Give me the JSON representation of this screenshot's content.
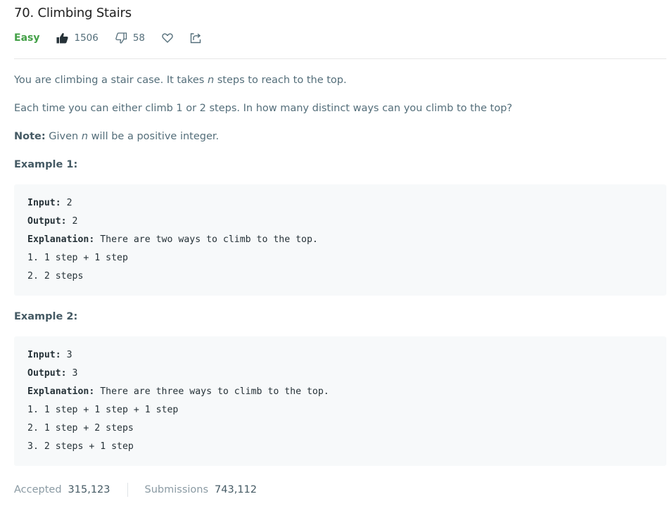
{
  "problem": {
    "title": "70. Climbing Stairs",
    "difficulty": "Easy",
    "likes": "1506",
    "dislikes": "58"
  },
  "description": {
    "p1_before": "You are climbing a stair case. It takes ",
    "p1_var": "n",
    "p1_after": " steps to reach to the top.",
    "p2": "Each time you can either climb 1 or 2 steps. In how many distinct ways can you climb to the top?",
    "note_label": "Note:",
    "note_before": " Given ",
    "note_var": "n",
    "note_after": " will be a positive integer."
  },
  "examples": [
    {
      "heading": "Example 1:",
      "input_label": "Input:",
      "input_value": " 2",
      "output_label": "Output:",
      "output_value": " 2",
      "explanation_label": "Explanation:",
      "explanation_value": " There are two ways to climb to the top.",
      "steps": [
        "1. 1 step + 1 step",
        "2. 2 steps"
      ]
    },
    {
      "heading": "Example 2:",
      "input_label": "Input:",
      "input_value": " 3",
      "output_label": "Output:",
      "output_value": " 3",
      "explanation_label": "Explanation:",
      "explanation_value": " There are three ways to climb to the top.",
      "steps": [
        "1. 1 step + 1 step + 1 step",
        "2. 1 step + 2 steps",
        "3. 2 steps + 1 step"
      ]
    }
  ],
  "stats": {
    "accepted_label": "Accepted",
    "accepted_value": "315,123",
    "submissions_label": "Submissions",
    "submissions_value": "743,112"
  },
  "icons": {
    "like": "thumbs-up-icon",
    "dislike": "thumbs-down-icon",
    "favorite": "heart-icon",
    "share": "share-icon"
  },
  "colors": {
    "difficulty_easy": "#43a047",
    "example_bg": "#f7f9fa",
    "text_muted": "#546e7a"
  }
}
